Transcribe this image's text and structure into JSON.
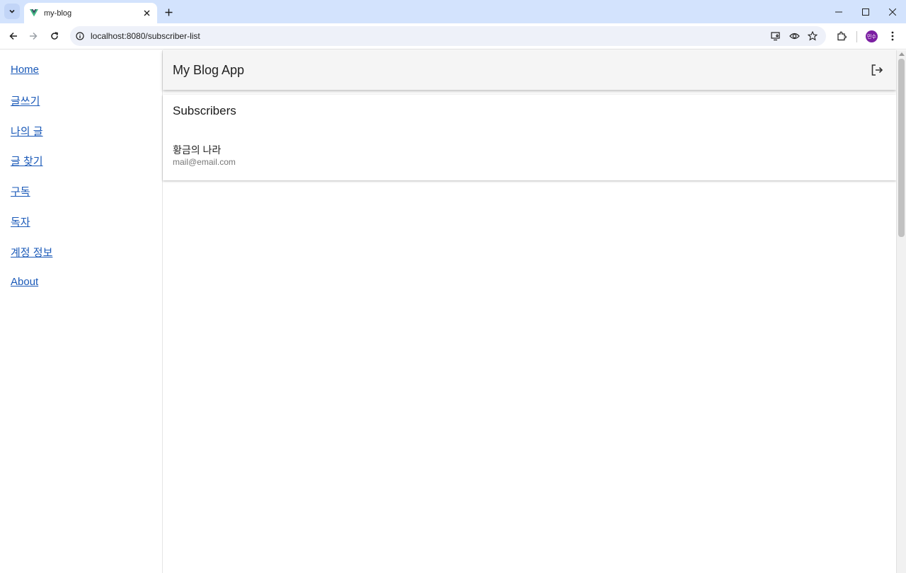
{
  "browser": {
    "tab_title": "my-blog",
    "url": "localhost:8080/subscriber-list",
    "profile_initials": "민수"
  },
  "sidebar": {
    "items": [
      {
        "label": "Home"
      },
      {
        "label": "글쓰기"
      },
      {
        "label": "나의 글"
      },
      {
        "label": "글 찾기"
      },
      {
        "label": "구독"
      },
      {
        "label": "독자"
      },
      {
        "label": "계정 정보"
      },
      {
        "label": "About"
      }
    ]
  },
  "appbar": {
    "title": "My Blog App"
  },
  "subscribers": {
    "heading": "Subscribers",
    "items": [
      {
        "name": "황금의 나라",
        "email": "mail@email.com"
      }
    ]
  },
  "colors": {
    "link": "#1a59b8",
    "appbar_bg": "#f5f5f5",
    "chrome_bg": "#d3e3fd"
  }
}
